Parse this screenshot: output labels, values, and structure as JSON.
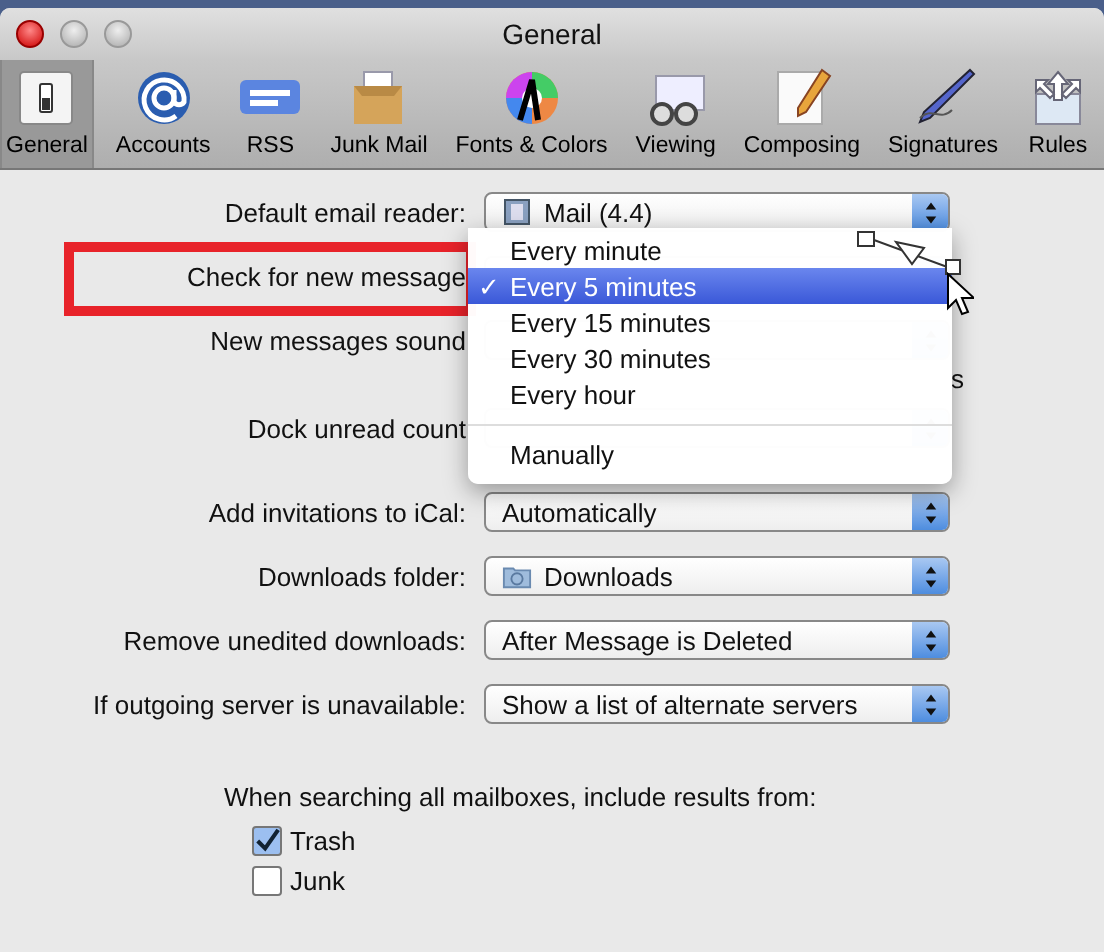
{
  "window": {
    "title": "General"
  },
  "toolbar": [
    {
      "label": "General",
      "selected": true
    },
    {
      "label": "Accounts",
      "selected": false
    },
    {
      "label": "RSS",
      "selected": false
    },
    {
      "label": "Junk Mail",
      "selected": false
    },
    {
      "label": "Fonts & Colors",
      "selected": false
    },
    {
      "label": "Viewing",
      "selected": false
    },
    {
      "label": "Composing",
      "selected": false
    },
    {
      "label": "Signatures",
      "selected": false
    },
    {
      "label": "Rules",
      "selected": false
    }
  ],
  "settings": [
    {
      "label": "Default email reader:",
      "value": "Mail (4.4)",
      "kind": "app"
    },
    {
      "label": "Check for new message",
      "kind": "covered"
    },
    {
      "label": "New messages sound",
      "kind": "covered"
    },
    {
      "label": "s",
      "kind": "note"
    },
    {
      "label": "Dock unread count",
      "kind": "covered"
    },
    {
      "label": "Add invitations to iCal:",
      "value": "Automatically",
      "kind": "popup"
    },
    {
      "label": "Downloads folder:",
      "value": "Downloads",
      "kind": "folder"
    },
    {
      "label": "Remove unedited downloads:",
      "value": "After Message is Deleted",
      "kind": "popup"
    },
    {
      "label": "If outgoing server is unavailable:",
      "value": "Show a list of alternate servers",
      "kind": "popup"
    }
  ],
  "menu": {
    "items": [
      {
        "kind": "item",
        "label": "Every minute",
        "selected": false
      },
      {
        "kind": "item",
        "label": "Every 5 minutes",
        "selected": true
      },
      {
        "kind": "item",
        "label": "Every 15 minutes",
        "selected": false
      },
      {
        "kind": "item",
        "label": "Every 30 minutes",
        "selected": false
      },
      {
        "kind": "item",
        "label": "Every hour",
        "selected": false
      },
      {
        "kind": "separator"
      },
      {
        "kind": "item",
        "label": "Manually",
        "selected": false
      }
    ],
    "check_mark": "✓"
  },
  "search": {
    "heading": "When searching all mailboxes, include results from:",
    "options": [
      {
        "label": "Trash",
        "checked": true
      },
      {
        "label": "Junk",
        "checked": false
      }
    ]
  }
}
